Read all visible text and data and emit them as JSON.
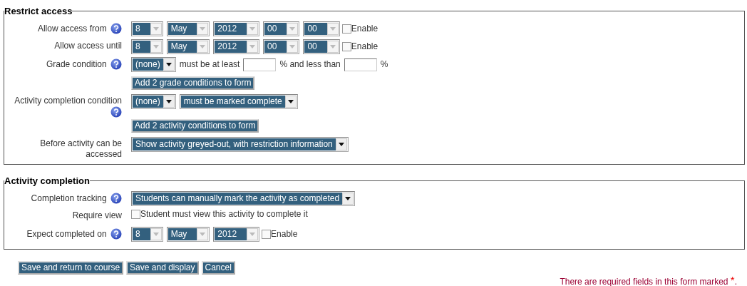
{
  "sections": [
    {
      "legend": "Restrict access",
      "rows": [
        {
          "label": "Allow access from",
          "help": true,
          "controls": [
            {
              "kind": "select",
              "value": "8",
              "disabled": true
            },
            {
              "kind": "select",
              "value": "May",
              "disabled": true
            },
            {
              "kind": "select",
              "value": "2012",
              "disabled": true
            },
            {
              "kind": "select",
              "value": "00",
              "disabled": true
            },
            {
              "kind": "select",
              "value": "00",
              "disabled": true
            },
            {
              "kind": "checkbox",
              "label": "Enable",
              "checked": false
            }
          ]
        },
        {
          "label": "Allow access until",
          "help": false,
          "controls": [
            {
              "kind": "select",
              "value": "8",
              "disabled": true
            },
            {
              "kind": "select",
              "value": "May",
              "disabled": true
            },
            {
              "kind": "select",
              "value": "2012",
              "disabled": true
            },
            {
              "kind": "select",
              "value": "00",
              "disabled": true
            },
            {
              "kind": "select",
              "value": "00",
              "disabled": true
            },
            {
              "kind": "checkbox",
              "label": "Enable",
              "checked": false
            }
          ]
        },
        {
          "label": "Grade condition",
          "help": true,
          "controls": [
            {
              "kind": "select",
              "value": "(none)",
              "disabled": false
            },
            {
              "kind": "text",
              "text": "must be at least"
            },
            {
              "kind": "input"
            },
            {
              "kind": "text",
              "text": "% and less than"
            },
            {
              "kind": "input"
            },
            {
              "kind": "text",
              "text": "%"
            }
          ]
        },
        {
          "controls": [
            {
              "kind": "button",
              "label": "Add 2 grade conditions to form"
            }
          ]
        },
        {
          "label": "Activity completion condition",
          "help": true,
          "controls": [
            {
              "kind": "select",
              "value": "(none)",
              "disabled": false
            },
            {
              "kind": "select",
              "value": "must be marked complete",
              "disabled": false
            }
          ]
        },
        {
          "controls": [
            {
              "kind": "button",
              "label": "Add 2 activity conditions to form"
            }
          ]
        },
        {
          "label": "Before activity can be accessed",
          "help": false,
          "controls": [
            {
              "kind": "select",
              "value": "Show activity greyed-out, with restriction information",
              "disabled": false
            }
          ]
        }
      ]
    },
    {
      "legend": "Activity completion",
      "rows": [
        {
          "label": "Completion tracking",
          "help": true,
          "controls": [
            {
              "kind": "select",
              "value": "Students can manually mark the activity as completed",
              "disabled": false
            }
          ]
        },
        {
          "label": "Require view",
          "help": false,
          "controls": [
            {
              "kind": "checkbox",
              "label": "Student must view this activity to complete it",
              "checked": false
            }
          ]
        },
        {
          "label": "Expect completed on",
          "help": true,
          "controls": [
            {
              "kind": "select",
              "value": "8",
              "disabled": true
            },
            {
              "kind": "select",
              "value": "May",
              "disabled": true
            },
            {
              "kind": "select",
              "value": "2012",
              "disabled": true
            },
            {
              "kind": "checkbox",
              "label": "Enable",
              "checked": false
            }
          ]
        }
      ]
    }
  ],
  "buttons": [
    "Save and return to course",
    "Save and display",
    "Cancel"
  ],
  "required_note": {
    "text": "There are required fields in this form marked",
    "mark": "*",
    "end": "."
  }
}
